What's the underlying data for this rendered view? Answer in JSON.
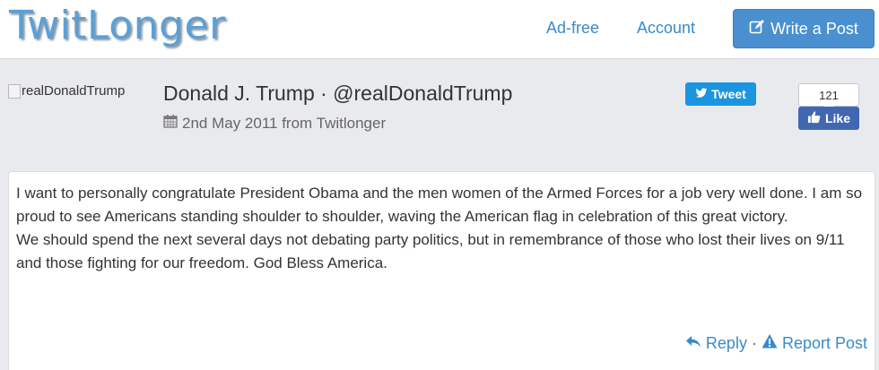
{
  "navbar": {
    "logo": "TwitLonger",
    "links": [
      "Ad-free",
      "Account"
    ],
    "write_button": "Write a Post"
  },
  "post_header": {
    "avatar_alt": "realDonaldTrump",
    "author": "Donald J. Trump · @realDonaldTrump",
    "date_source": "2nd May 2011 from Twitlonger",
    "tweet_button": "Tweet",
    "like_count": "121",
    "like_button": "Like"
  },
  "post": {
    "paragraphs": [
      "I want to personally congratulate President Obama and the men women of the Armed Forces for a job very well done. I am so proud to see Americans standing shoulder to shoulder, waving the American flag in celebration of this great victory.",
      "We should spend the next several days not debating party politics, but in remembrance of those who lost their lives on 9/11 and those fighting for our freedom. God Bless America."
    ]
  },
  "actions": {
    "reply": "Reply",
    "separator": "·",
    "report": "Report Post"
  },
  "colors": {
    "brand": "#5aa0d8",
    "link": "#3a8ac7",
    "primary_button": "#4a90d0",
    "twitter": "#1b95e0",
    "facebook": "#4267b2",
    "page_bg": "#e9eaed"
  },
  "icons": {
    "write": "edit-icon",
    "date": "calendar-icon",
    "tweet": "twitter-bird-icon",
    "like": "thumbs-up-icon",
    "reply": "reply-arrow-icon",
    "report": "warning-icon"
  }
}
